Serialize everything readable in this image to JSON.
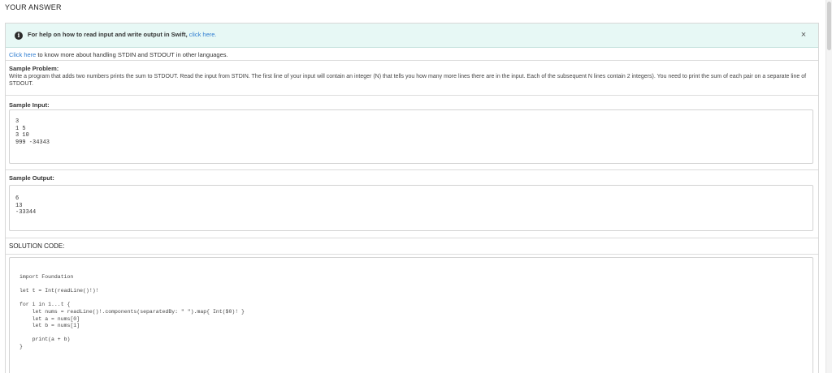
{
  "section_title": "YOUR ANSWER",
  "alert": {
    "icon": "info-icon",
    "text": "For help on how to read input and write output in Swift, ",
    "link": "click here.",
    "close_label": "×"
  },
  "handling": {
    "link": "Click here",
    "text": " to know more about handling STDIN and STDOUT in other languages."
  },
  "problem": {
    "label": "Sample Problem:",
    "description": "Write a program that adds two numbers prints the sum to STDOUT. Read the input from STDIN. The first line of your input will contain an integer (N) that tells you how many more lines there are in the input. Each of the subsequent N lines contain 2 integers). You need to print the sum of each pair on a separate line of STDOUT."
  },
  "sample_input": {
    "label": "Sample Input:",
    "content": "3\n1 5\n3 10\n999 -34343"
  },
  "sample_output": {
    "label": "Sample Output:",
    "content": "6\n13\n-33344"
  },
  "solution": {
    "label": "SOLUTION CODE:",
    "code": "import Foundation\n\nlet t = Int(readLine()!)!\n\nfor i in 1...t {\n    let nums = readLine()!.components(separatedBy: \" \").map{ Int($0)! }\n    let a = nums[0]\n    let b = nums[1]\n\n    print(a + b)\n}"
  }
}
